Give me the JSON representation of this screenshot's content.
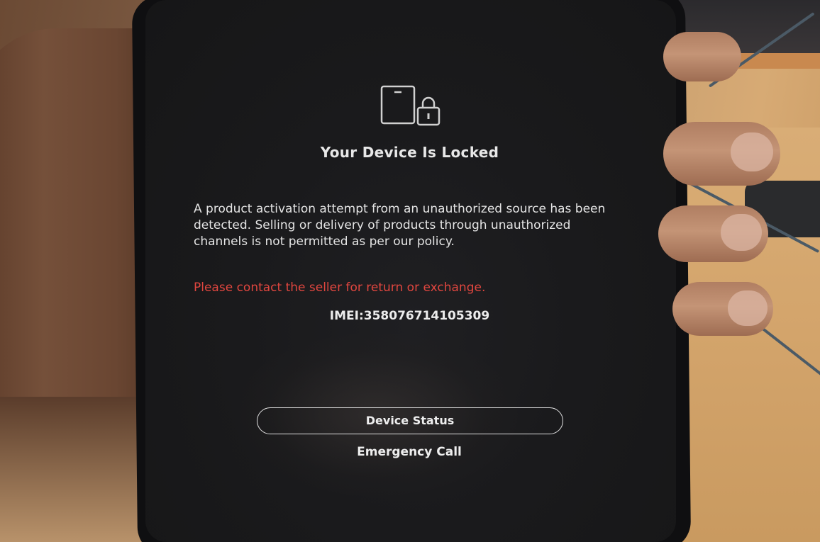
{
  "lock_screen": {
    "icon": "tablet-lock-icon",
    "title": "Your Device Is Locked",
    "message": "A product activation attempt from an unauthorized source has been detected. Selling or delivery of products through unauthorized channels is not permitted as per our policy.",
    "warning": "Please contact the seller for return or exchange.",
    "imei": "IMEI:358076714105309",
    "device_status_label": "Device Status",
    "emergency_call_label": "Emergency Call"
  },
  "colors": {
    "screen_background": "#1a1a1c",
    "text": "#e4e4e4",
    "warning_text": "#e0463f"
  }
}
